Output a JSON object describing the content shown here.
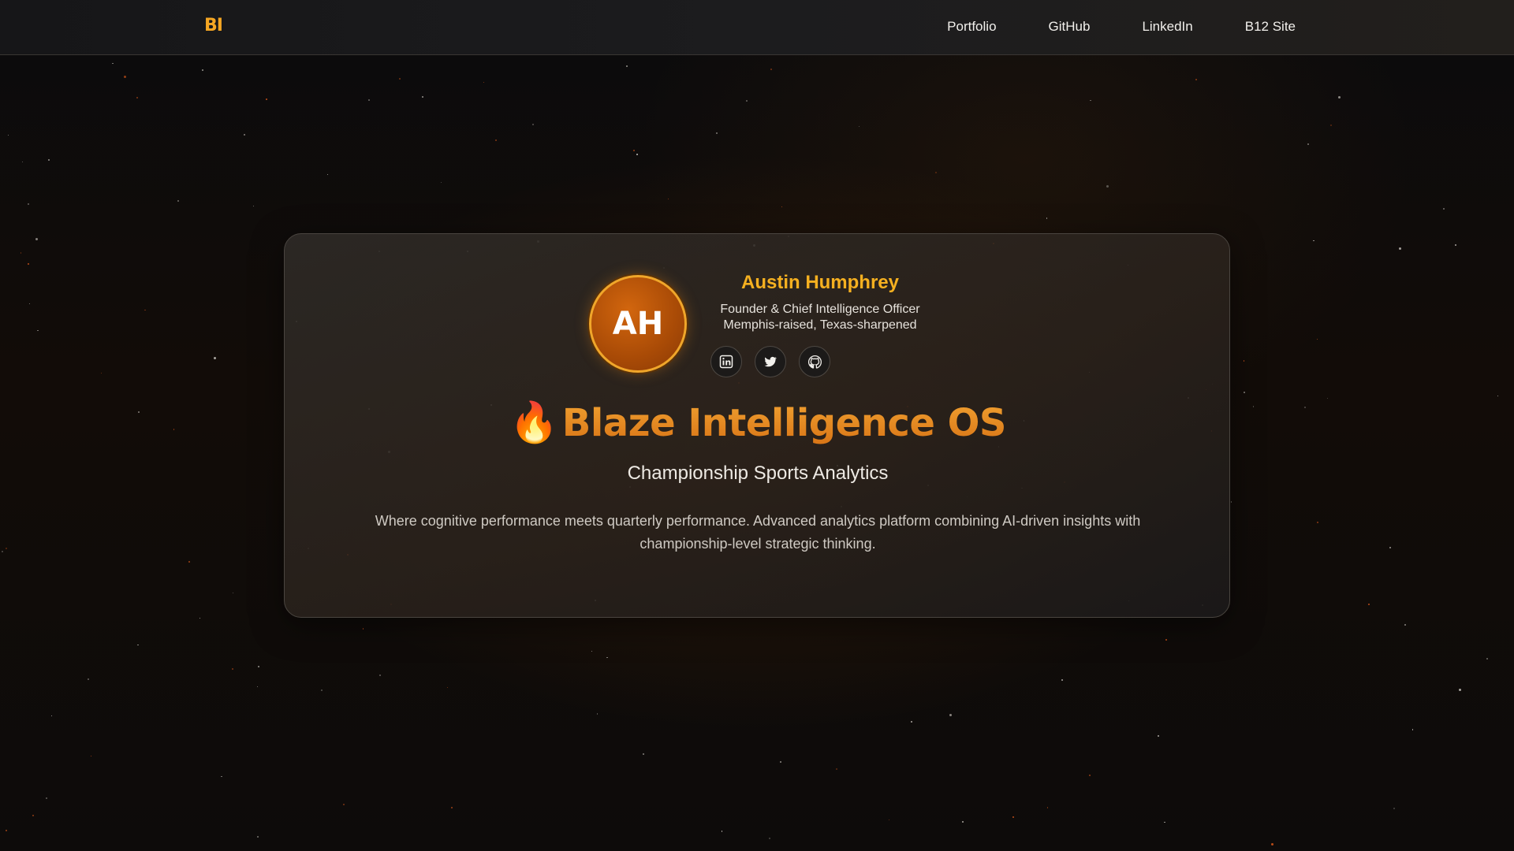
{
  "nav": {
    "logo": "BI",
    "links": [
      "Portfolio",
      "GitHub",
      "LinkedIn",
      "B12 Site"
    ]
  },
  "profile": {
    "initials": "AH",
    "name": "Austin Humphrey",
    "role": "Founder & Chief Intelligence Officer",
    "origin": "Memphis-raised, Texas-sharpened",
    "socials": [
      "linkedin-icon",
      "twitter-icon",
      "github-icon"
    ]
  },
  "hero": {
    "title": "Blaze Intelligence OS",
    "subtitle": "Championship Sports Analytics",
    "description": "Where cognitive performance meets quarterly performance. Advanced analytics platform combining AI-driven insights with championship-level strategic thinking."
  },
  "colors": {
    "accent": "#f5a623",
    "name": "#f5b020",
    "title": "#e0861a",
    "background": "#0d0b0a"
  }
}
